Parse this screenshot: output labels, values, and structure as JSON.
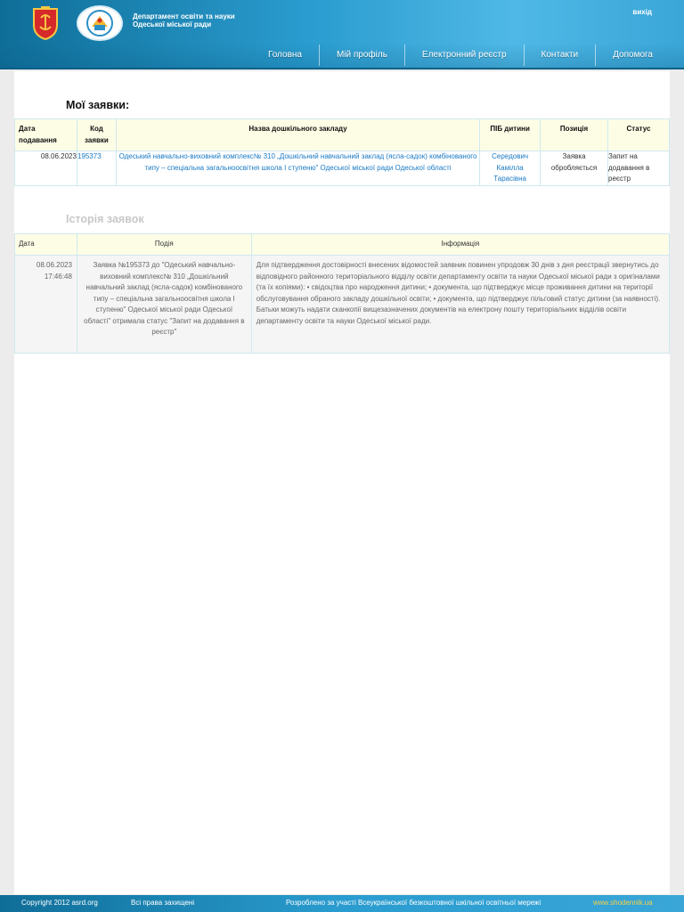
{
  "header": {
    "dept_name": "Департамент освіти та науки Одеської міської ради",
    "logout": "вихід",
    "nav": [
      "Головна",
      "Мій профіль",
      "Електронний реєстр",
      "Контакти",
      "Допомога"
    ]
  },
  "requests": {
    "title": "Мої заявки:",
    "columns": [
      "Дата подавання",
      "Код заявки",
      "Назва дошкільного закладу",
      "ПІБ дитини",
      "Позиція",
      "Статус"
    ],
    "rows": [
      {
        "date": "08.06.2023",
        "code": "195373",
        "institution": "Одеський навчально-виховний комплекс№ 310 „Дошкільний навчальний заклад (ясла-садок) комбінованого типу – спеціальна загальноосвітня школа І ступеню\" Одеської міської ради Одеської області",
        "child": "Середович Камілла Тарасівна",
        "position": "Заявка обробляється",
        "status": "Запит на додавання в реєстр"
      }
    ]
  },
  "history": {
    "title": "Історія заявок",
    "columns": [
      "Дата",
      "Подія",
      "Інформація"
    ],
    "rows": [
      {
        "date": "08.06.2023 17:46:48",
        "event": "Заявка №195373 до \"Одеський навчально-виховний комплекс№ 310 „Дошкільний навчальний заклад (ясла-садок) комбінованого типу – спеціальна загальноосвітня школа І ступеню\" Одеської міської ради Одеської області\" отримала статус \"Запит на додавання в реєстр\"",
        "info": "Для підтвердження достовірності внесених відомостей заявник повинен упродовж 30 днів з дня реєстрації звернутись до відповідного районного територіального відділу освіти департаменту освіти та науки Одеської міської ради з оригіналами (та їх копіями): • свідоцтва про народження дитини; • документа, що підтверджує місце проживання дитини на території обслуговування обраного закладу дошкільної освіти; • документа, що підтверджує пільговий статус дитини (за наявності). Батьки можуть надати сканкопії вищезазначених документів на електрону пошту територіальних відділів освіти департаменту освіти та науки Одеської міської ради."
      }
    ]
  },
  "footer": {
    "copyright": "Copyright 2012 asrd.org",
    "rights": "Всі права захищені",
    "developed": "Розроблено за участі Всеукраїнської безкоштовної шкільної освітньої мережі",
    "site": "www.shodennik.ua"
  }
}
